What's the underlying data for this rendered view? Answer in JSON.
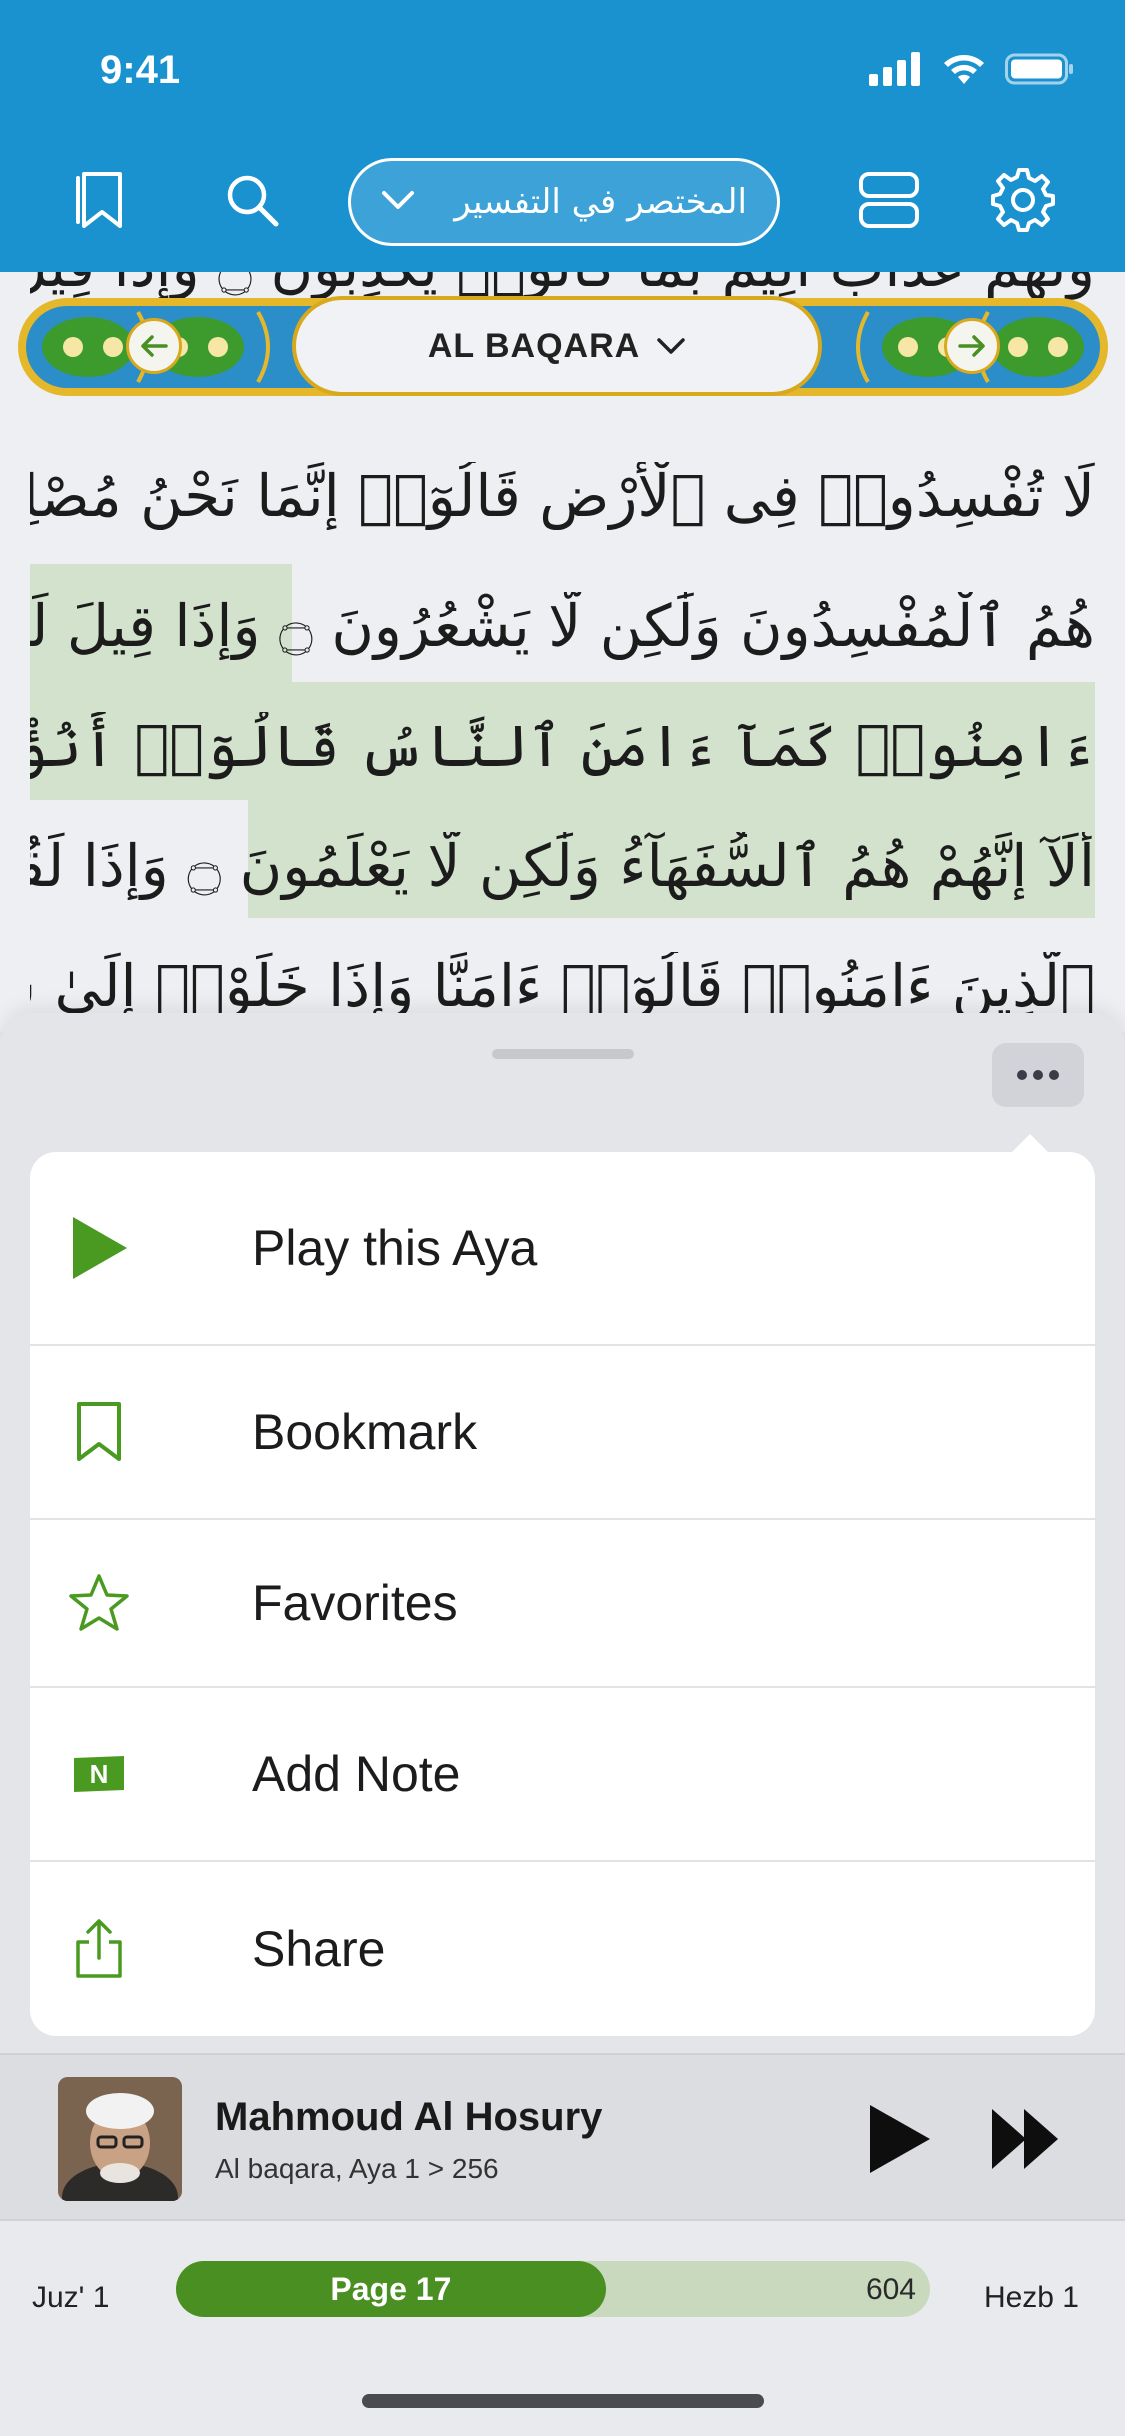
{
  "status_bar": {
    "time": "9:41"
  },
  "header": {
    "tafsir_label": "المختصر في التفسير",
    "icons": [
      "bookmark-icon",
      "search-icon",
      "chevron-down-icon",
      "layout-icon",
      "gear-icon"
    ]
  },
  "quran": {
    "surah_name": "AL BAQARA",
    "lines": [
      "وَلَهُمْ عَذَابٌ أَلِيمٌ بِمَا كَانُوا۟ يَكْذِبُونَ ۝ وَإِذَا قِيلَ لَهُمْ",
      "لَا تُفْسِدُوا۟ فِى ٱلْأَرْضِ قَالُوٓا۟ إِنَّمَا نَحْنُ مُصْلِحُونَ ۝ أَلَآ إِنَّهُمْ",
      "هُمُ ٱلْمُفْسِدُونَ وَلَٰكِن لَّا يَشْعُرُونَ ۝ وَإِذَا قِيلَ لَهُمْ",
      "ءَامِنُوا۟ كَمَآ ءَامَنَ ٱلنَّاسُ قَالُوٓا۟ أَنُؤْمِنُ كَمَآ ءَامَنَ ٱلسُّفَهَآءُ",
      "أَلَآ إِنَّهُمْ هُمُ ٱلسُّفَهَآءُ وَلَٰكِن لَّا يَعْلَمُونَ ۝ وَإِذَا لَقُوا۟",
      "ٱلَّذِينَ ءَامَنُوا۟ قَالُوٓا۟ ءَامَنَّا وَإِذَا خَلَوْا۟ إِلَىٰ شَيَٰطِينِهِمْ قَالُوٓا۟ إِنَّا"
    ]
  },
  "menu": {
    "items": [
      {
        "label": "Play this Aya",
        "icon": "play-icon"
      },
      {
        "label": "Bookmark",
        "icon": "bookmark-icon"
      },
      {
        "label": "Favorites",
        "icon": "star-icon"
      },
      {
        "label": "Add Note",
        "icon": "note-icon",
        "icon_text": "N"
      },
      {
        "label": "Share",
        "icon": "share-icon"
      }
    ]
  },
  "player": {
    "reciter": "Mahmoud Al Hosury",
    "subtitle": "Al baqara, Aya 1 > 256"
  },
  "page_indicator": {
    "juz": "Juz' 1",
    "page_label": "Page 17",
    "total_pages": "604",
    "hezb": "Hezb 1",
    "progress_fraction": 0.57
  },
  "colors": {
    "header_blue": "#1a92d0",
    "accent_green": "#4a8f22",
    "highlight_green": "#d3e2cc",
    "ornament_gold": "#d9a91d"
  }
}
